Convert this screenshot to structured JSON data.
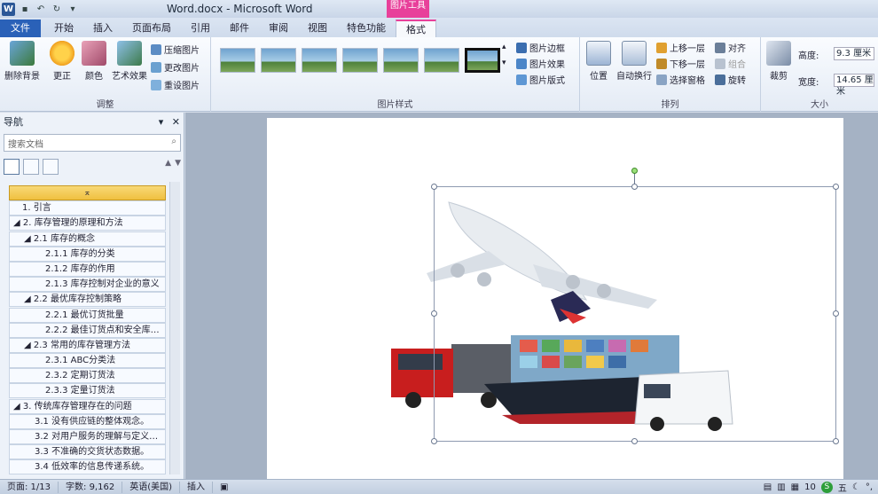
{
  "window": {
    "title": "Word.docx  -  Microsoft Word",
    "context_tool_label": "图片工具"
  },
  "quick_access": {
    "logo": "W"
  },
  "tabs": [
    {
      "label": "文件"
    },
    {
      "label": "开始"
    },
    {
      "label": "插入"
    },
    {
      "label": "页面布局"
    },
    {
      "label": "引用"
    },
    {
      "label": "邮件"
    },
    {
      "label": "审阅"
    },
    {
      "label": "视图"
    },
    {
      "label": "特色功能"
    },
    {
      "label": "格式"
    }
  ],
  "ribbon": {
    "adjust": {
      "label": "调整",
      "remove_bg": "删除背景",
      "corrections": "更正",
      "color": "颜色",
      "artistic": "艺术效果",
      "compress": "压缩图片",
      "change": "更改图片",
      "reset": "重设图片"
    },
    "styles": {
      "label": "图片样式",
      "border": "图片边框",
      "effects": "图片效果",
      "layout": "图片版式"
    },
    "arrange": {
      "label": "排列",
      "position": "位置",
      "wrap": "自动换行",
      "bring_forward": "上移一层",
      "send_backward": "下移一层",
      "selection_pane": "选择窗格",
      "align": "对齐",
      "group": "组合",
      "rotate": "旋转"
    },
    "size": {
      "label": "大小",
      "crop": "裁剪",
      "height_label": "高度:",
      "height_value": "9.3 厘米",
      "width_label": "宽度:",
      "width_value": "14.65 厘米"
    }
  },
  "nav": {
    "title": "导航",
    "search_placeholder": "搜索文档",
    "items": [
      {
        "label": "1. 引言"
      },
      {
        "label": "◢ 2. 库存管理的原理和方法"
      },
      {
        "label": "◢ 2.1 库存的概念"
      },
      {
        "label": "2.1.1 库存的分类"
      },
      {
        "label": "2.1.2 库存的作用"
      },
      {
        "label": "2.1.3 库存控制对企业的意义"
      },
      {
        "label": "◢ 2.2 最优库存控制策略"
      },
      {
        "label": "2.2.1 最优订货批量"
      },
      {
        "label": "2.2.2 最佳订货点和安全库存..."
      },
      {
        "label": "◢ 2.3 常用的库存管理方法"
      },
      {
        "label": "2.3.1 ABC分类法"
      },
      {
        "label": "2.3.2 定期订货法"
      },
      {
        "label": "2.3.3 定量订货法"
      },
      {
        "label": "◢ 3. 传统库存管理存在的问题"
      },
      {
        "label": "3.1 没有供应链的整体观念。"
      },
      {
        "label": "3.2 对用户服务的理解与定义不..."
      },
      {
        "label": "3.3 不准确的交货状态数据。"
      },
      {
        "label": "3.4 低效率的信息传递系统。"
      }
    ]
  },
  "status": {
    "page": "页面: 1/13",
    "words": "字数: 9,162",
    "language": "英语(美国)",
    "mode": "插入",
    "zoom": "10",
    "ime_label": "五"
  }
}
